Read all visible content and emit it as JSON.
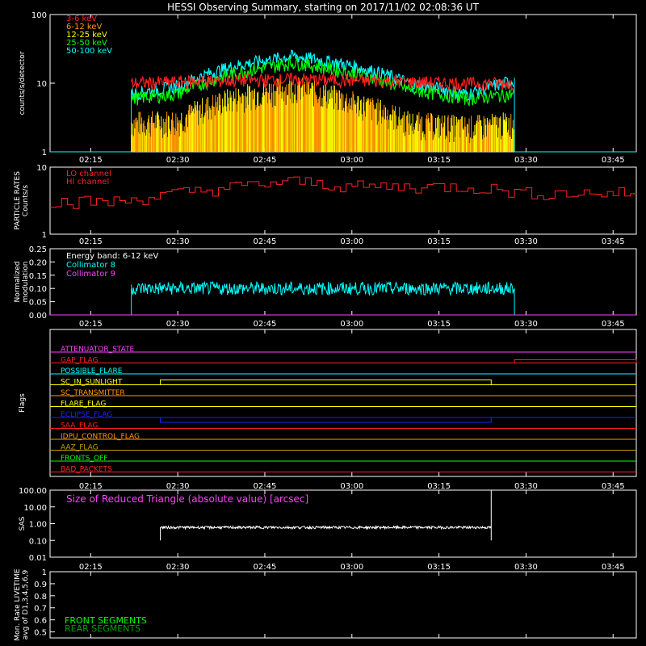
{
  "title": "HESSI Observing Summary, starting on 2017/11/02 02:08:36 UT",
  "time_axis": {
    "start": "02:08",
    "end": "03:49",
    "ticks": [
      "02:15",
      "02:30",
      "02:45",
      "03:00",
      "03:15",
      "03:30",
      "03:45"
    ]
  },
  "chart_data": [
    {
      "type": "line",
      "ylabel": "counts/s/detector",
      "yscale": "log",
      "ylim": [
        1,
        100
      ],
      "yticks": [
        "1",
        "10",
        "100"
      ],
      "legend": [
        {
          "label": "3-6 keV",
          "color": "#ff2020"
        },
        {
          "label": "6-12 keV",
          "color": "#ff9a00"
        },
        {
          "label": "12-25 keV",
          "color": "#ffff00"
        },
        {
          "label": "25-50 keV",
          "color": "#00ff00"
        },
        {
          "label": "50-100 keV",
          "color": "#00ffff"
        }
      ],
      "series": [
        {
          "name": "3-6 keV",
          "color": "#ff2020",
          "x": [
            "02:22",
            "02:30",
            "02:40",
            "02:50",
            "03:00",
            "03:10",
            "03:20",
            "03:28"
          ],
          "y": [
            10,
            10.5,
            11,
            11.5,
            11,
            10.5,
            10,
            10
          ]
        },
        {
          "name": "12-25 keV",
          "color": "#ffff00",
          "x": [
            "02:22",
            "02:30",
            "02:40",
            "02:50",
            "03:00",
            "03:10",
            "03:20",
            "03:28"
          ],
          "y": [
            1.5,
            1.6,
            3.5,
            5,
            3,
            1.5,
            1.3,
            1.5
          ]
        },
        {
          "name": "25-50 keV",
          "color": "#00ff00",
          "x": [
            "02:22",
            "02:30",
            "02:40",
            "02:50",
            "03:00",
            "03:10",
            "03:20",
            "03:28"
          ],
          "y": [
            6,
            7,
            14,
            20,
            14,
            8,
            6,
            7
          ]
        },
        {
          "name": "50-100 keV",
          "color": "#00ffff",
          "x": [
            "02:22",
            "02:30",
            "02:40",
            "02:50",
            "03:00",
            "03:10",
            "03:20",
            "03:28"
          ],
          "y": [
            7,
            9,
            18,
            25,
            18,
            10,
            7,
            11
          ]
        }
      ]
    },
    {
      "type": "line",
      "ylabel": "PARTICLE RATES",
      "ylabel2": "Counts/s",
      "yscale": "log",
      "ylim": [
        1,
        10
      ],
      "yticks": [
        "1",
        "10"
      ],
      "legend": [
        {
          "label": "LO channel",
          "color": "#ff2020"
        },
        {
          "label": "HI channel",
          "color": "#ff2020"
        }
      ],
      "series": [
        {
          "name": "LO channel",
          "color": "#ff2020",
          "x": [
            "02:08",
            "02:20",
            "02:30",
            "02:40",
            "02:50",
            "03:00",
            "03:10",
            "03:20",
            "03:30",
            "03:40",
            "03:49"
          ],
          "y": [
            3,
            3,
            4,
            5,
            6,
            5,
            5,
            5,
            4,
            4,
            4
          ]
        }
      ]
    },
    {
      "type": "line",
      "ylabel": "Normalized",
      "ylabel2": "modulation",
      "ylim": [
        0,
        0.25
      ],
      "yticks": [
        "0.00",
        "0.05",
        "0.10",
        "0.15",
        "0.20",
        "0.25"
      ],
      "legend": [
        {
          "label": "Energy band: 6-12 keV",
          "color": "#ffffff"
        },
        {
          "label": "Collimator 8",
          "color": "#00ffff"
        },
        {
          "label": "Collimator 9",
          "color": "#ff40ff"
        }
      ],
      "series": [
        {
          "name": "Collimator 8",
          "color": "#00ffff",
          "x": [
            "02:22",
            "03:28"
          ],
          "y": [
            0.1,
            0.1
          ]
        },
        {
          "name": "Collimator 9",
          "color": "#ff40ff",
          "x": [
            "02:08",
            "03:49"
          ],
          "y": [
            0,
            0
          ]
        }
      ]
    },
    {
      "type": "line",
      "ylabel": "Flags",
      "flags": [
        {
          "label": "ATTENUATOR_STATE",
          "color": "#ff40ff"
        },
        {
          "label": "GAP_FLAG",
          "color": "#ff2020"
        },
        {
          "label": "POSSIBLE_FLARE",
          "color": "#00ffff"
        },
        {
          "label": "SC_IN_SUNLIGHT",
          "color": "#ffff00"
        },
        {
          "label": "SC_TRANSMITTER",
          "color": "#ff9a00"
        },
        {
          "label": "FLARE_FLAG",
          "color": "#ffff00"
        },
        {
          "label": "ECLIPSE_FLAG",
          "color": "#2020ff"
        },
        {
          "label": "SAA_FLAG",
          "color": "#ff2020"
        },
        {
          "label": "IDPU_CONTROL_FLAG",
          "color": "#ff9a00"
        },
        {
          "label": "AAZ_FLAG",
          "color": "#c0a000"
        },
        {
          "label": "FRONTS_OFF",
          "color": "#00ff00"
        },
        {
          "label": "BAD_PACKETS",
          "color": "#ff2020"
        }
      ]
    },
    {
      "type": "line",
      "ylabel": "SAS",
      "yscale": "log",
      "ylim": [
        0.01,
        100
      ],
      "yticks": [
        "0.01",
        "0.10",
        "1.00",
        "10.00",
        "100.00"
      ],
      "annotation": "Size of Reduced Triangle (absolute value) [arcsec]",
      "annotation_color": "#ff40ff",
      "series": [
        {
          "x": [
            "02:27",
            "03:24"
          ],
          "y": [
            0.6,
            0.6
          ]
        }
      ]
    },
    {
      "type": "line",
      "ylabel": "Mon. Rate LIVETIME",
      "ylabel2": "avg of D1,3,4,5,6,9",
      "ylim": [
        0,
        1
      ],
      "yticks": [
        "0.5",
        "0.6",
        "0.7",
        "0.8",
        "0.9",
        "1"
      ],
      "legend": [
        {
          "label": "FRONT SEGMENTS",
          "color": "#00ff00"
        },
        {
          "label": "REAR SEGMENTS",
          "color": "#00a000"
        }
      ]
    }
  ]
}
